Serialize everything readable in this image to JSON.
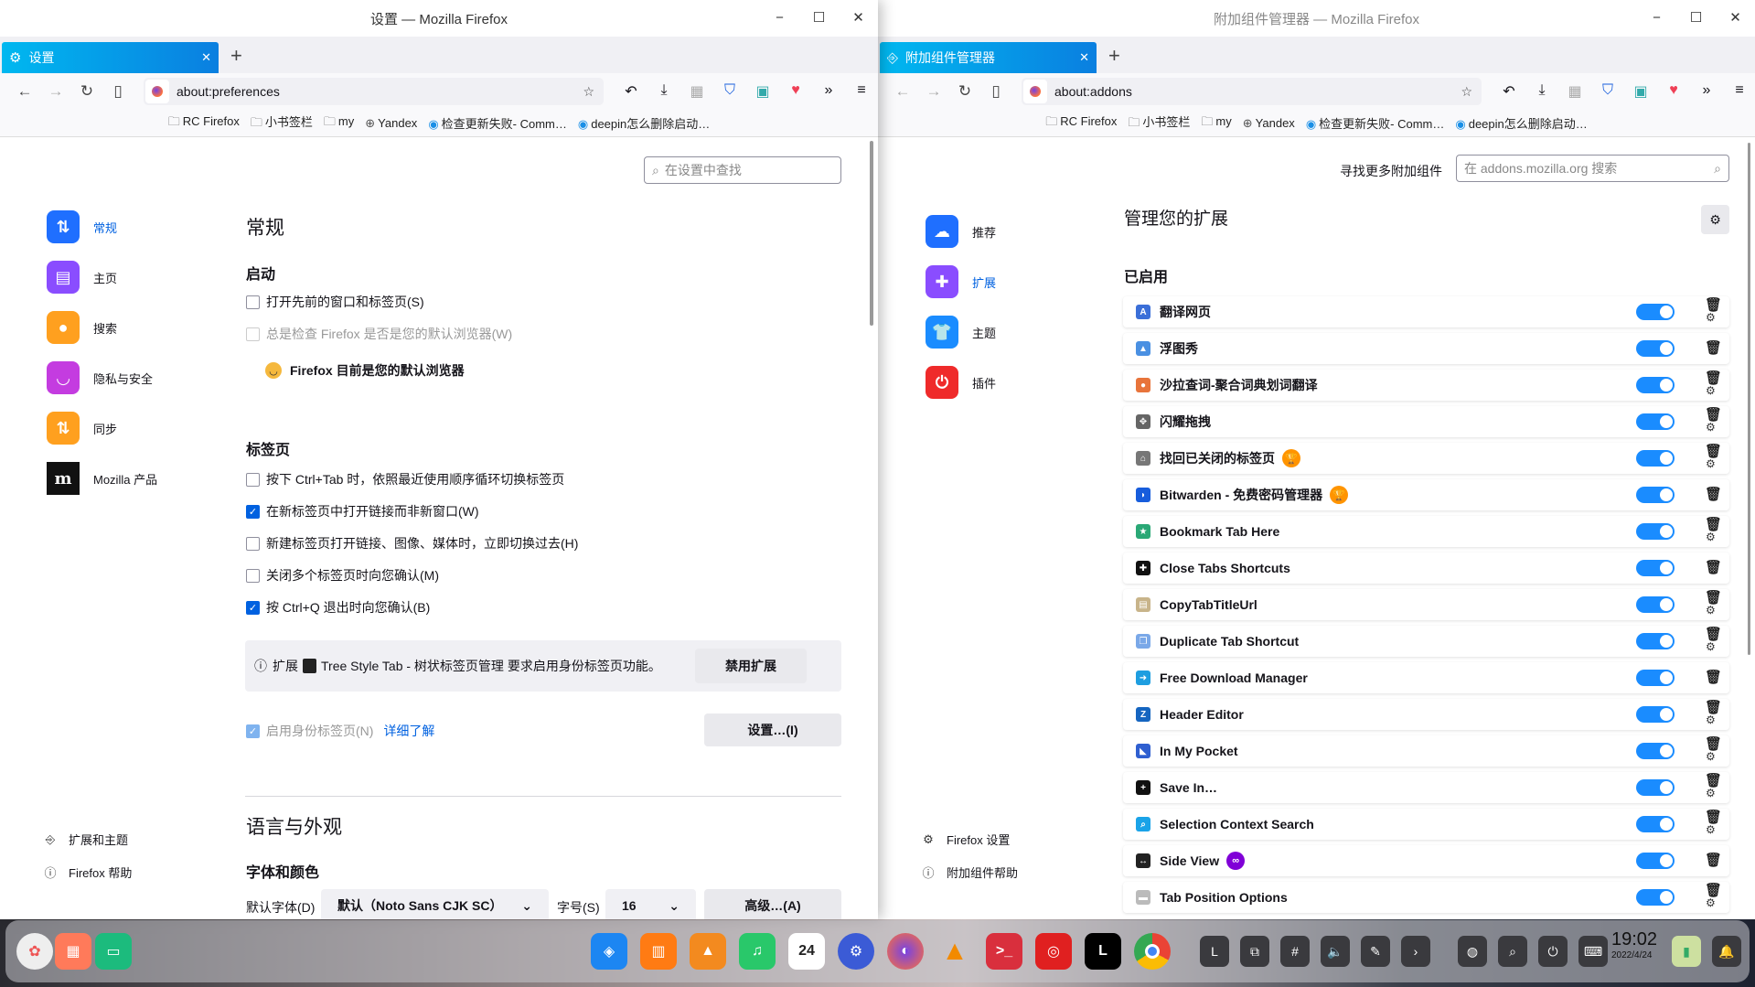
{
  "left_window": {
    "title": "设置 — Mozilla Firefox",
    "tab_label": "设置",
    "url": "about:preferences",
    "bookmarks": [
      "RC Firefox",
      "小书签栏",
      "my",
      "Yandex",
      "检查更新失败- Comm…",
      "deepin怎么删除启动…"
    ],
    "search_placeholder": "在设置中查找",
    "sidebar": [
      "常规",
      "主页",
      "搜索",
      "隐私与安全",
      "同步",
      "Mozilla 产品"
    ],
    "sidebar_footer": [
      "扩展和主题",
      "Firefox 帮助"
    ],
    "heading": "常规",
    "startup": {
      "title": "启动",
      "restore_session": "打开先前的窗口和标签页(S)",
      "check_default": "总是检查 Firefox 是否是您的默认浏览器(W)",
      "default_status": "Firefox 目前是您的默认浏览器"
    },
    "tabs": {
      "title": "标签页",
      "options": [
        {
          "label": "按下 Ctrl+Tab 时，依照最近使用顺序循环切换标签页",
          "checked": false
        },
        {
          "label": "在新标签页中打开链接而非新窗口(W)",
          "checked": true
        },
        {
          "label": "新建标签页打开链接、图像、媒体时，立即切换过去(H)",
          "checked": false
        },
        {
          "label": "关闭多个标签页时向您确认(M)",
          "checked": false
        },
        {
          "label": "按 Ctrl+Q 退出时向您确认(B)",
          "checked": true
        }
      ],
      "notice_prefix": "扩展",
      "notice_text": "Tree Style Tab - 树状标签页管理 要求启用身份标签页功能。",
      "disable_ext_button": "禁用扩展",
      "containers_label": "启用身份标签页(N)",
      "learn_more": "详细了解",
      "settings_button": "设置…(I)"
    },
    "appearance": {
      "title": "语言与外观",
      "fonts_title": "字体和颜色",
      "default_font_label": "默认字体(D)",
      "default_font_value": "默认（Noto Sans CJK SC）",
      "size_label": "字号(S)",
      "size_value": "16",
      "advanced_button": "高级…(A)"
    }
  },
  "right_window": {
    "title": "附加组件管理器 — Mozilla Firefox",
    "tab_label": "附加组件管理器",
    "url": "about:addons",
    "bookmarks": [
      "RC Firefox",
      "小书签栏",
      "my",
      "Yandex",
      "检查更新失败- Comm…",
      "deepin怎么删除启动…"
    ],
    "find_more_label": "寻找更多附加组件",
    "search_placeholder": "在 addons.mozilla.org 搜索",
    "sidebar": [
      "推荐",
      "扩展",
      "主题",
      "插件"
    ],
    "sidebar_footer": [
      "Firefox 设置",
      "附加组件帮助"
    ],
    "heading": "管理您的扩展",
    "enabled_title": "已启用",
    "extensions": [
      {
        "name": "翻译网页",
        "icon": "translate-icon",
        "color": "#3b6fd8",
        "glyph": "A",
        "enabled": true,
        "options": true,
        "badge": null
      },
      {
        "name": "浮图秀",
        "icon": "image-icon",
        "color": "#4a90e2",
        "glyph": "▲",
        "enabled": true,
        "options": false,
        "badge": null
      },
      {
        "name": "沙拉查词-聚合词典划词翻译",
        "icon": "salad-icon",
        "color": "#e8743b",
        "glyph": "●",
        "enabled": true,
        "options": true,
        "badge": null
      },
      {
        "name": "闪耀拖拽",
        "icon": "move-icon",
        "color": "#666666",
        "glyph": "✥",
        "enabled": true,
        "options": true,
        "badge": null
      },
      {
        "name": "找回已关闭的标签页",
        "icon": "undo-tab-icon",
        "color": "#777777",
        "glyph": "⌂",
        "enabled": true,
        "options": true,
        "badge": "recommended"
      },
      {
        "name": "Bitwarden - 免费密码管理器",
        "icon": "bitwarden-icon",
        "color": "#175ddc",
        "glyph": "◗",
        "enabled": true,
        "options": false,
        "badge": "recommended"
      },
      {
        "name": "Bookmark Tab Here",
        "icon": "bookmark-icon",
        "color": "#2aa876",
        "glyph": "★",
        "enabled": true,
        "options": true,
        "badge": null
      },
      {
        "name": "Close Tabs Shortcuts",
        "icon": "puzzle-icon",
        "color": "#111111",
        "glyph": "✚",
        "enabled": true,
        "options": false,
        "badge": null
      },
      {
        "name": "CopyTabTitleUrl",
        "icon": "clipboard-icon",
        "color": "#c8b48a",
        "glyph": "▤",
        "enabled": true,
        "options": true,
        "badge": null
      },
      {
        "name": "Duplicate Tab Shortcut",
        "icon": "duplicate-icon",
        "color": "#7aa8e8",
        "glyph": "❐",
        "enabled": true,
        "options": true,
        "badge": null
      },
      {
        "name": "Free Download Manager",
        "icon": "download-manager-icon",
        "color": "#1e9ee0",
        "glyph": "➜",
        "enabled": true,
        "options": false,
        "badge": null
      },
      {
        "name": "Header Editor",
        "icon": "header-editor-icon",
        "color": "#1565c0",
        "glyph": "Z",
        "enabled": true,
        "options": true,
        "badge": null
      },
      {
        "name": "In My Pocket",
        "icon": "pocket-icon",
        "color": "#2f5fd0",
        "glyph": "◣",
        "enabled": true,
        "options": true,
        "badge": null
      },
      {
        "name": "Save In…",
        "icon": "save-in-icon",
        "color": "#111111",
        "glyph": "+",
        "enabled": true,
        "options": true,
        "badge": null
      },
      {
        "name": "Selection Context Search",
        "icon": "search-ext-icon",
        "color": "#1aa3e8",
        "glyph": "⌕",
        "enabled": true,
        "options": true,
        "badge": null
      },
      {
        "name": "Side View",
        "icon": "side-view-icon",
        "color": "#222222",
        "glyph": "↔",
        "enabled": true,
        "options": false,
        "badge": "firefox"
      },
      {
        "name": "Tab Position Options",
        "icon": "tab-position-icon",
        "color": "#bbbbbb",
        "glyph": "▬",
        "enabled": true,
        "options": true,
        "badge": null
      }
    ]
  },
  "dock": {
    "calendar_day": "24",
    "time": "19:02",
    "date": "2022/4/24"
  },
  "colors": {
    "accent": "#0061e0",
    "toggle": "#1a8cff",
    "tab_gradient_start": "#00b8f0",
    "tab_gradient_end": "#0a7fe0",
    "recommended_badge": "#ff9400",
    "firefox_badge": "#8000d7"
  }
}
